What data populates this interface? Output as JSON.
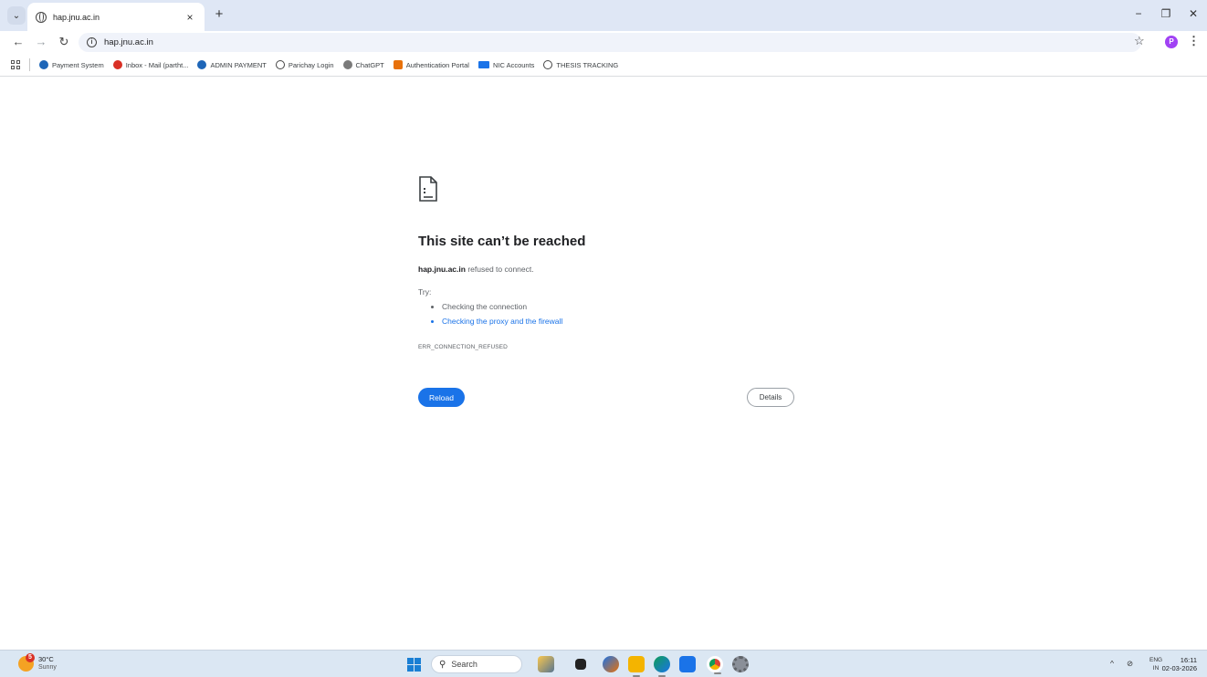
{
  "browser": {
    "tab": {
      "title": "hap.jnu.ac.in",
      "close": "×"
    },
    "new_tab": "+",
    "window_controls": {
      "minimize": "−",
      "restore": "❐",
      "close": "✕"
    },
    "nav": {
      "back": "←",
      "forward": "→",
      "reload": "↻"
    },
    "address": "hap.jnu.ac.in",
    "bookmark_star": "☆",
    "profile_initial": "P",
    "menu": "⋮"
  },
  "bookmarks": [
    {
      "label": "Payment System",
      "icon": "globe-blue"
    },
    {
      "label": "Inbox - Mail (partht...",
      "icon": "mail-red"
    },
    {
      "label": "ADMIN PAYMENT",
      "icon": "globe-blue"
    },
    {
      "label": "Parichay Login",
      "icon": "globe"
    },
    {
      "label": "ChatGPT",
      "icon": "chatgpt"
    },
    {
      "label": "Authentication Portal",
      "icon": "portal-orange"
    },
    {
      "label": "NIC Accounts",
      "icon": "nic"
    },
    {
      "label": "THESIS TRACKING",
      "icon": "globe"
    }
  ],
  "error": {
    "heading": "This site can’t be reached",
    "host": "hap.jnu.ac.in",
    "message_suffix": " refused to connect.",
    "try_label": "Try:",
    "suggestions": [
      "Checking the connection",
      "Checking the proxy and the firewall"
    ],
    "code": "ERR_CONNECTION_REFUSED",
    "reload_label": "Reload",
    "details_label": "Details"
  },
  "taskbar": {
    "weather_badge": "5",
    "temperature": "30°C",
    "condition": "Sunny",
    "search_placeholder": "Search",
    "lang_top": "ENG",
    "lang_bottom": "IN",
    "time": "16:11",
    "date": "02-03-2026"
  },
  "colors": {
    "accent": "#1a73e8",
    "tabstrip": "#dfe7f5",
    "taskbar": "#dbe7f3"
  }
}
